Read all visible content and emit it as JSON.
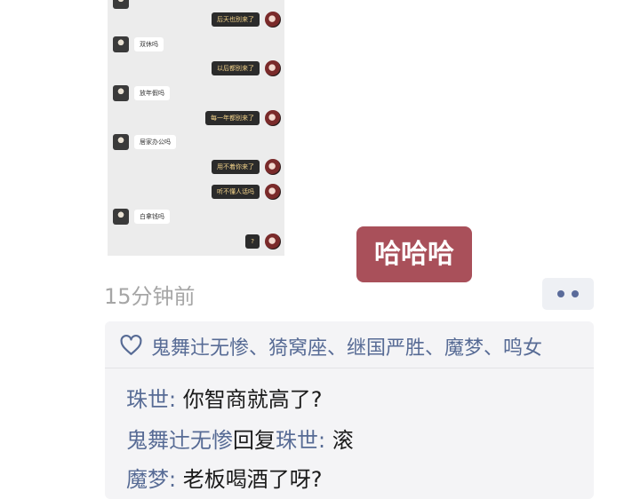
{
  "chat": {
    "messages": [
      {
        "side": "right",
        "text": "后天也别来了"
      },
      {
        "side": "left",
        "text": "双休吗"
      },
      {
        "side": "right",
        "text": "以后都别来了"
      },
      {
        "side": "left",
        "text": "放年假吗"
      },
      {
        "side": "right",
        "text": "每一年都别来了"
      },
      {
        "side": "left",
        "text": "居家办公吗"
      },
      {
        "side": "right",
        "text": "用不着你来了"
      },
      {
        "side": "right",
        "text": "听不懂人话吗"
      },
      {
        "side": "left",
        "text": "白拿钱吗"
      },
      {
        "side": "right",
        "text": "?"
      }
    ]
  },
  "caption": "哈哈哈",
  "post": {
    "timestamp": "15分钟前"
  },
  "likes": {
    "names_text": "鬼舞辻无惨、猗窝座、继国严胜、魔梦、鸣女"
  },
  "comments": [
    {
      "author": "珠世",
      "reply_word": "",
      "reply_to": "",
      "sep": ": ",
      "text": "你智商就高了?"
    },
    {
      "author": "鬼舞辻无惨",
      "reply_word": "回复",
      "reply_to": "珠世",
      "sep": ": ",
      "text": "滚"
    },
    {
      "author": "魔梦",
      "reply_word": "",
      "reply_to": "",
      "sep": ": ",
      "text": "老板喝酒了呀?"
    }
  ],
  "colors": {
    "name_link": "#576b95",
    "caption_bg": "#a9505a",
    "timestamp": "#a6a6a6"
  },
  "icons": {
    "like": "heart-outline-icon",
    "more": "more-dots-icon"
  }
}
